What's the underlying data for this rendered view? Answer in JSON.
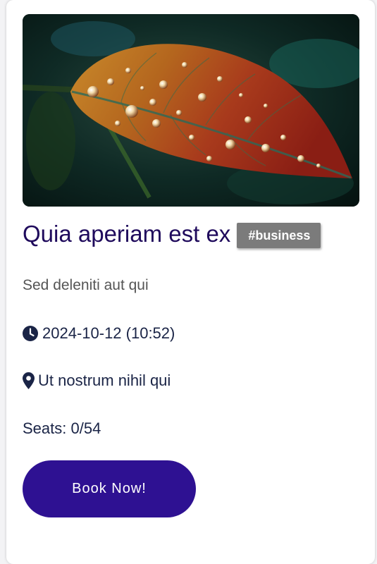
{
  "event": {
    "image_alt": "leaf-with-water-droplets",
    "title": "Quia aperiam est ex",
    "tag": "#business",
    "description": "Sed deleniti aut qui",
    "datetime": "2024-10-12 (10:52)",
    "location": "Ut nostrum nihil qui",
    "seats": "Seats: 0/54",
    "book_label": "Book Now!"
  },
  "icons": {
    "datetime": "clock-icon",
    "location": "map-pin-icon"
  },
  "colors": {
    "title": "#1f0a5c",
    "button": "#2e1192",
    "tag": "#7b7b7b",
    "info_text": "#1a2446"
  }
}
